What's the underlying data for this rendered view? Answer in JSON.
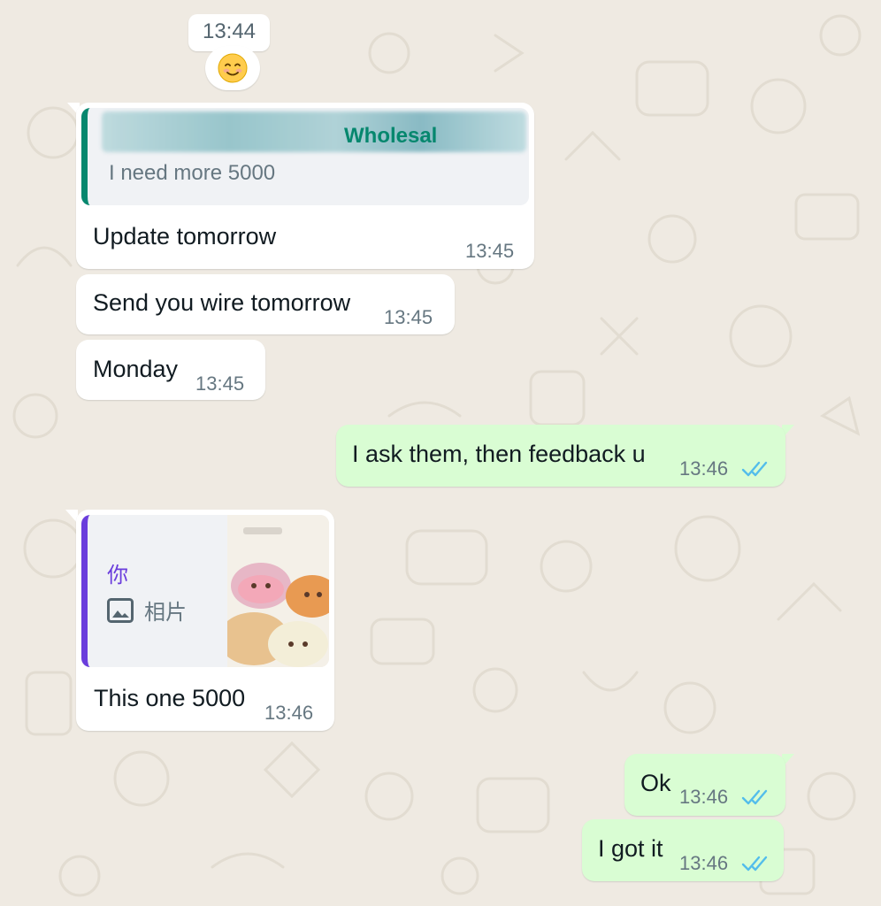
{
  "date_chip": "13:44",
  "emoji_message": {
    "emoji_name": "smiling-face-icon"
  },
  "colors": {
    "chat_bg": "#efeae2",
    "incoming_bubble": "#ffffff",
    "outgoing_bubble": "#d9fdd3",
    "read_tick": "#53bdeb",
    "quote_bar_1": "#06876e",
    "quote_bar_2": "#6a3ddc"
  },
  "messages": [
    {
      "direction": "incoming",
      "quote": {
        "sender": "Wholesal",
        "text": "I need more 5000"
      },
      "text": "Update tomorrow",
      "time": "13:45"
    },
    {
      "direction": "incoming",
      "text": "Send you wire tomorrow",
      "time": "13:45"
    },
    {
      "direction": "incoming",
      "text": "Monday",
      "time": "13:45"
    },
    {
      "direction": "outgoing",
      "text": "I ask them, then feedback u",
      "time": "13:46",
      "status": "read"
    },
    {
      "direction": "incoming",
      "quote": {
        "sender": "你",
        "media_label": "相片",
        "media_icon": "image-icon"
      },
      "text": "This one 5000",
      "time": "13:46"
    },
    {
      "direction": "outgoing",
      "text": "Ok",
      "time": "13:46",
      "status": "read"
    },
    {
      "direction": "outgoing",
      "text": "I got it",
      "time": "13:46",
      "status": "read"
    }
  ]
}
